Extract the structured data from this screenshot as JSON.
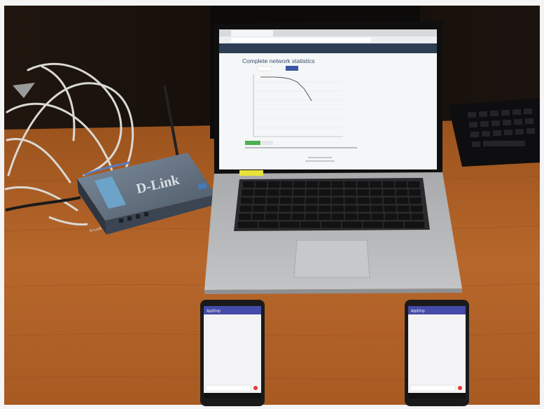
{
  "photo": {
    "kind": "photograph",
    "colors": {
      "wall": "#17110d",
      "desk": "#b05f26",
      "laptop_body": "#b8b9bb",
      "keyboard_keys": "#141414",
      "router_body": "#5c6a7a",
      "phone_body": "#1a1a1a",
      "phone_accent": "#444ba8"
    }
  },
  "router": {
    "brand": "D-Link",
    "front_label": "D-Link"
  },
  "laptop": {
    "browser_tab": "",
    "address_bar": "",
    "nav_items": [
      "",
      "",
      "",
      ""
    ],
    "page_title": "Complete network statistics",
    "sticky_note_color": "#e8e23a",
    "chart_data": {
      "type": "line",
      "title": "",
      "xlabel": "",
      "ylabel": "",
      "series": [
        {
          "values": [
            100,
            100,
            100,
            99,
            97,
            92,
            80,
            60
          ]
        }
      ]
    }
  },
  "phones": [
    {
      "app_title": "AppDrop"
    },
    {
      "app_title": "AppDrop"
    }
  ]
}
